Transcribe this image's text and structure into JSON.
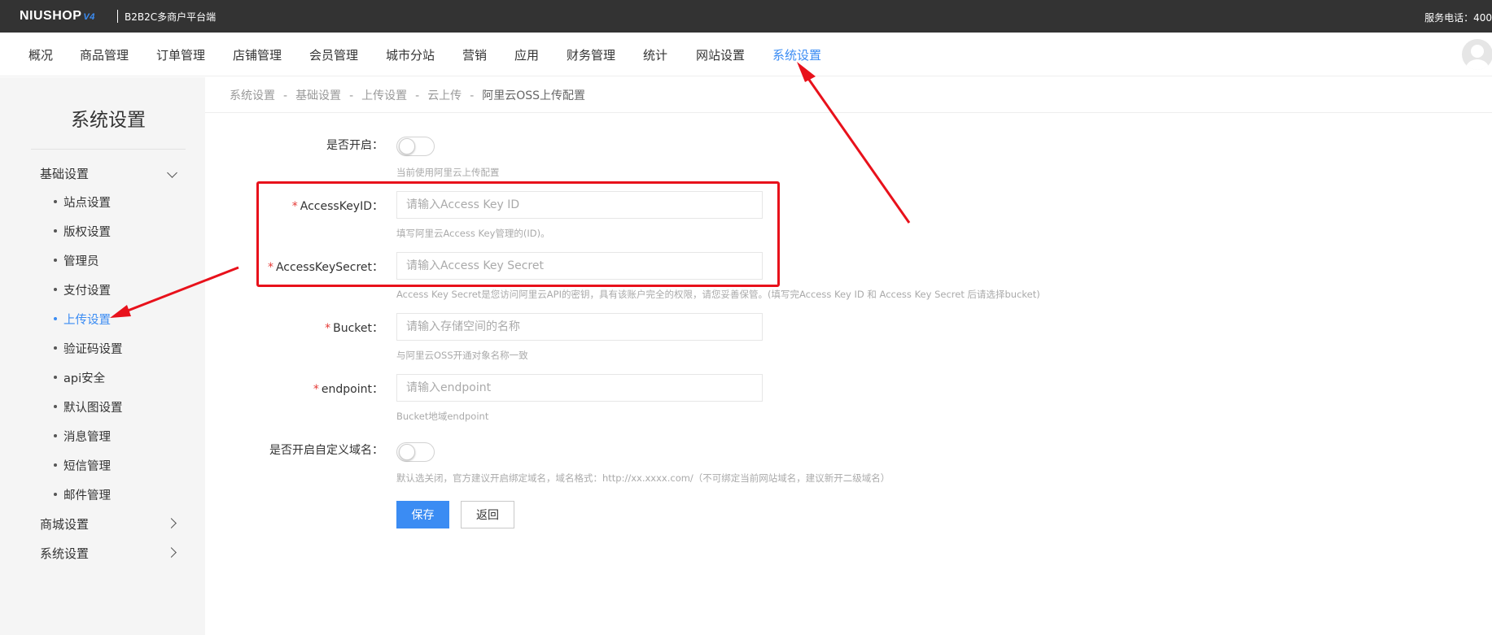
{
  "header": {
    "logo_text": "NIUSHOP",
    "logo_version": "V4",
    "platform": "B2B2C多商户平台端",
    "phone": "服务电话：400"
  },
  "nav": {
    "items": [
      "概况",
      "商品管理",
      "订单管理",
      "店铺管理",
      "会员管理",
      "城市分站",
      "营销",
      "应用",
      "财务管理",
      "统计",
      "网站设置",
      "系统设置"
    ],
    "active": "系统设置"
  },
  "sidebar": {
    "title": "系统设置",
    "groups": [
      {
        "label": "基础设置",
        "expanded": true
      },
      {
        "label": "商城设置",
        "expanded": false
      },
      {
        "label": "系统设置",
        "expanded": false
      }
    ],
    "sub_items": [
      "站点设置",
      "版权设置",
      "管理员",
      "支付设置",
      "上传设置",
      "验证码设置",
      "api安全",
      "默认图设置",
      "消息管理",
      "短信管理",
      "邮件管理"
    ],
    "active_sub": "上传设置"
  },
  "breadcrumb": {
    "items": [
      "系统设置",
      "基础设置",
      "上传设置",
      "云上传",
      "阿里云OSS上传配置"
    ],
    "separator": "-"
  },
  "form": {
    "enable": {
      "label": "是否开启：",
      "on": false,
      "hint": "当前使用阿里云上传配置"
    },
    "access_key_id": {
      "label": "AccessKeyID：",
      "placeholder": "请输入Access Key ID",
      "value": "",
      "hint": "填写阿里云Access Key管理的(ID)。"
    },
    "access_key_secret": {
      "label": "AccessKeySecret：",
      "placeholder": "请输入Access Key Secret",
      "value": "",
      "hint": "Access Key Secret是您访问阿里云API的密钥，具有该账户完全的权限，请您妥善保管。(填写完Access Key ID 和 Access Key Secret 后请选择bucket)"
    },
    "bucket": {
      "label": "Bucket：",
      "placeholder": "请输入存储空间的名称",
      "value": "",
      "hint": "与阿里云OSS开通对象名称一致"
    },
    "endpoint": {
      "label": "endpoint：",
      "placeholder": "请输入endpoint",
      "value": "",
      "hint": "Bucket地域endpoint"
    },
    "custom_domain": {
      "label": "是否开启自定义域名：",
      "on": false,
      "hint": "默认选关闭，官方建议开启绑定域名，域名格式：http://xx.xxxx.com/（不可绑定当前网站域名，建议新开二级域名）"
    },
    "required_mark": "*",
    "save_label": "保存",
    "back_label": "返回"
  },
  "colors": {
    "accent": "#3b8cf3",
    "topbar": "#333333",
    "annotation": "#e8111b",
    "required": "#e53935"
  }
}
